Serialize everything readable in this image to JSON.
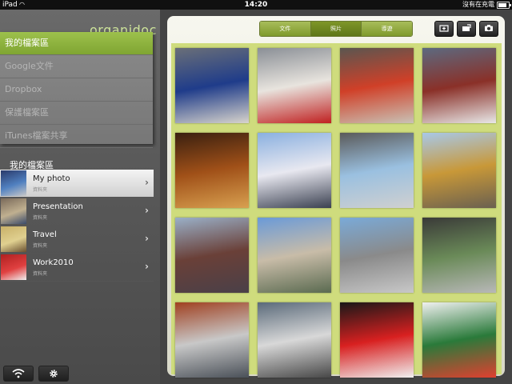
{
  "status": {
    "device": "iPad",
    "time": "14:20",
    "charging": "沒有在充電",
    "battery_level": 0.85
  },
  "logo": "organidoc",
  "menu": [
    {
      "label": "我的檔案區",
      "active": true
    },
    {
      "label": "Google文件",
      "active": false
    },
    {
      "label": "Dropbox",
      "active": false
    },
    {
      "label": "保護檔案區",
      "active": false
    },
    {
      "label": "iTunes檔案共享",
      "active": false
    }
  ],
  "section_title": "我的檔案區",
  "folders": [
    {
      "name": "My photo",
      "sub": "資料夾",
      "active": true,
      "colors": [
        "#2a3a6a",
        "#5080c0",
        "#c8c8c8"
      ]
    },
    {
      "name": "Presentation",
      "sub": "資料夾",
      "active": false,
      "colors": [
        "#7a6a5a",
        "#c0b090",
        "#3a4a6a"
      ]
    },
    {
      "name": "Travel",
      "sub": "資料夾",
      "active": false,
      "colors": [
        "#c8b068",
        "#e0d090",
        "#6a5030"
      ]
    },
    {
      "name": "Work2010",
      "sub": "資料夾",
      "active": false,
      "colors": [
        "#b02020",
        "#e04040",
        "#f0f0f0"
      ]
    }
  ],
  "segments": [
    {
      "label": "文件",
      "active": false
    },
    {
      "label": "照片",
      "active": true
    },
    {
      "label": "導遊",
      "active": false
    }
  ],
  "toolbar_icons": [
    "add-folder-icon",
    "image-import-icon",
    "camera-icon"
  ],
  "bottom_icons": [
    "wifi-icon",
    "gear-icon"
  ],
  "photos": [
    {
      "colors": [
        "#6a6f78",
        "#1f3c8a",
        "#d8d4cc"
      ]
    },
    {
      "colors": [
        "#8a8f96",
        "#e8e4de",
        "#c02020"
      ]
    },
    {
      "colors": [
        "#5a5650",
        "#d04028",
        "#c9c2b6"
      ]
    },
    {
      "colors": [
        "#5c6a80",
        "#8a3028",
        "#e8e8e8"
      ]
    },
    {
      "colors": [
        "#3a2010",
        "#a05018",
        "#d8a050"
      ]
    },
    {
      "colors": [
        "#8ab0e0",
        "#e8e8f0",
        "#3a4050"
      ]
    },
    {
      "colors": [
        "#5a5a5a",
        "#9ac0e0",
        "#d0d0d0"
      ]
    },
    {
      "colors": [
        "#a8c8e8",
        "#c89838",
        "#6a6050"
      ]
    },
    {
      "colors": [
        "#9ab0c8",
        "#6a4038",
        "#4a4048"
      ]
    },
    {
      "colors": [
        "#6a9ad8",
        "#c8bca8",
        "#5a6a50"
      ]
    },
    {
      "colors": [
        "#7aaad8",
        "#8a8a8a",
        "#c8c8c8"
      ]
    },
    {
      "colors": [
        "#3a3a38",
        "#6a8a58",
        "#b8b8b8"
      ]
    },
    {
      "colors": [
        "#a04020",
        "#c8c8c8",
        "#4a5058"
      ]
    },
    {
      "colors": [
        "#5a6a7a",
        "#d8d8d8",
        "#484848"
      ]
    },
    {
      "colors": [
        "#181818",
        "#d82020",
        "#f0f0f0"
      ]
    },
    {
      "colors": [
        "#f0f0f0",
        "#2a7a3a",
        "#e04030"
      ]
    }
  ]
}
